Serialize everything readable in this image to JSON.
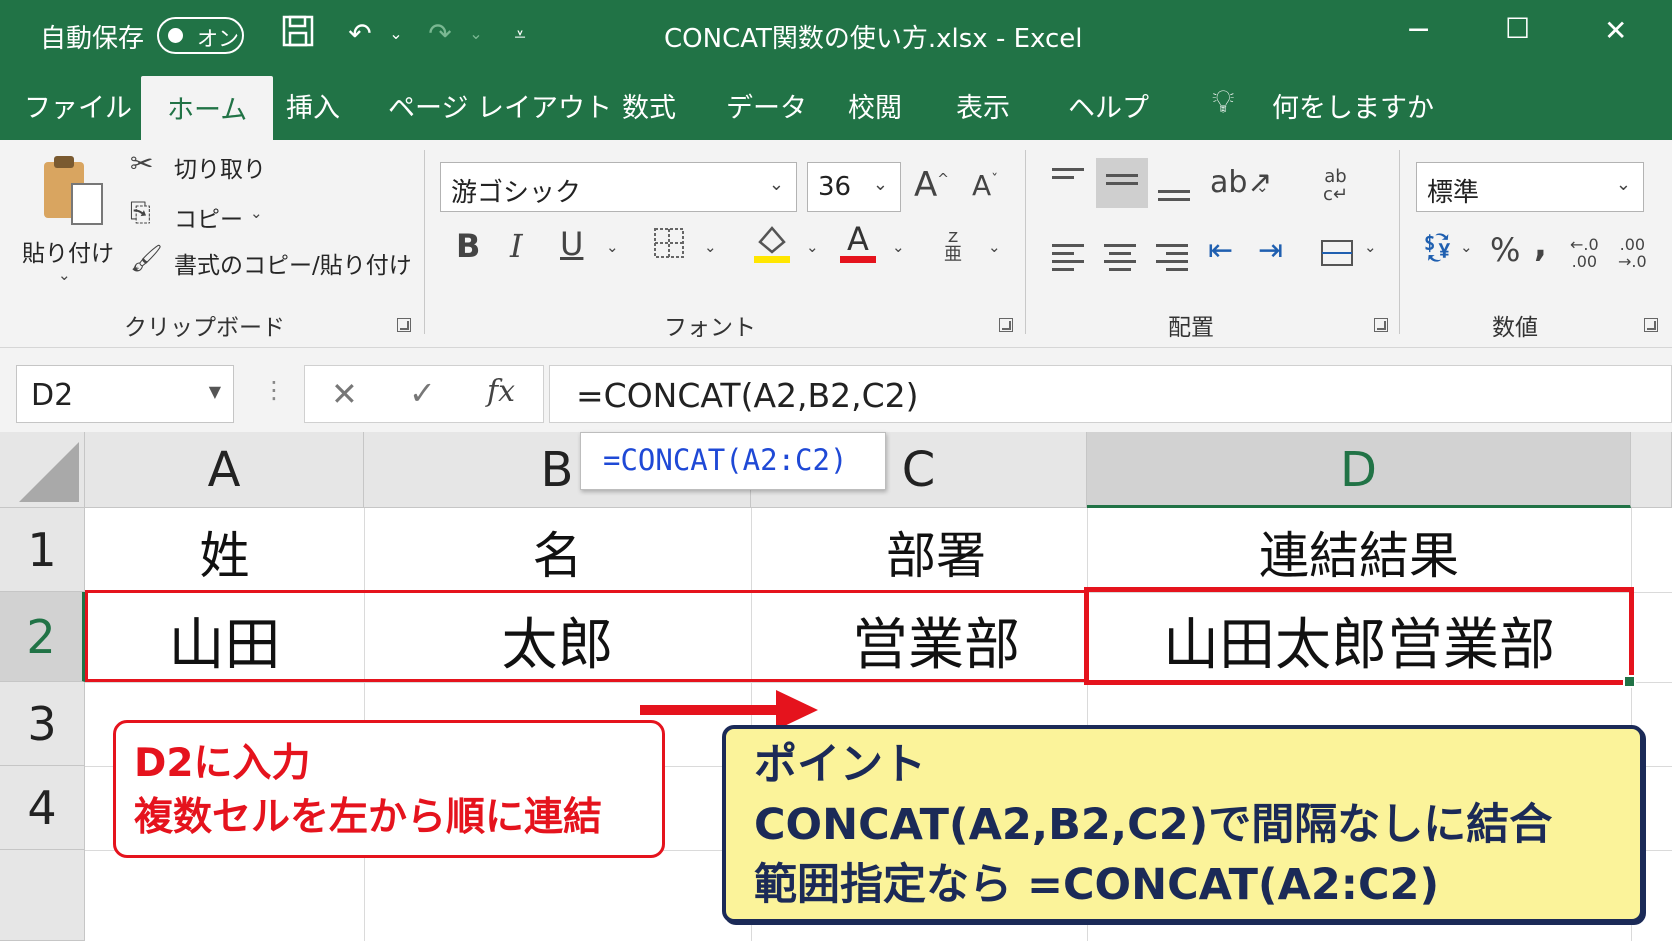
{
  "titlebar": {
    "autosave_label": "自動保存",
    "autosave_state": "オン",
    "doc_title": "CONCAT関数の使い方.xlsx  -  Excel",
    "minimize": "−",
    "maximize": "☐",
    "close": "✕"
  },
  "menu": {
    "tabs": [
      "ファイル",
      "ホーム",
      "挿入",
      "ページ レイアウト",
      "数式",
      "データ",
      "校閲",
      "表示",
      "ヘルプ"
    ],
    "active": "ホーム",
    "tellme": "何をしますか"
  },
  "ribbon": {
    "clipboard": {
      "paste": "貼り付け",
      "cut": "切り取り",
      "copy": "コピー",
      "format_painter": "書式のコピー/貼り付け",
      "group": "クリップボード"
    },
    "font": {
      "font_name": "游ゴシック",
      "font_size": "36",
      "bold": "B",
      "italic": "I",
      "underline": "U",
      "group": "フォント"
    },
    "alignment": {
      "group": "配置"
    },
    "number": {
      "format": "標準",
      "percent": "%",
      "comma": ",",
      "group": "数値"
    }
  },
  "formula_bar": {
    "name_box": "D2",
    "cancel": "✕",
    "enter": "✓",
    "fx": "fx",
    "formula": "=CONCAT(A2,B2,C2)"
  },
  "grid": {
    "columns": [
      "A",
      "B",
      "C",
      "D"
    ],
    "rows": [
      "1",
      "2",
      "3",
      "4"
    ],
    "selected_cell": "D2",
    "cells": {
      "A1": "姓",
      "B1": "名",
      "C1": "部署",
      "D1": "連結結果",
      "A2": "山田",
      "B2": "太郎",
      "C2": "営業部",
      "D2": "山田太郎営業部"
    }
  },
  "tooltip": "=CONCAT(A2:C2)",
  "callout_red": {
    "line1": "D2に入力",
    "line2": "複数セルを左から順に連結"
  },
  "callout_yellow": {
    "line1": "ポイント",
    "line2": "CONCAT(A2,B2,C2)で間隔なしに結合",
    "line3": "範囲指定なら =CONCAT(A2:C2)"
  },
  "colors": {
    "excel_green": "#217346",
    "highlight_red": "#e5131d",
    "callout_yellow_bg": "#fbf39a",
    "callout_navy": "#1b2a57",
    "tooltip_blue": "#1f49d6"
  }
}
